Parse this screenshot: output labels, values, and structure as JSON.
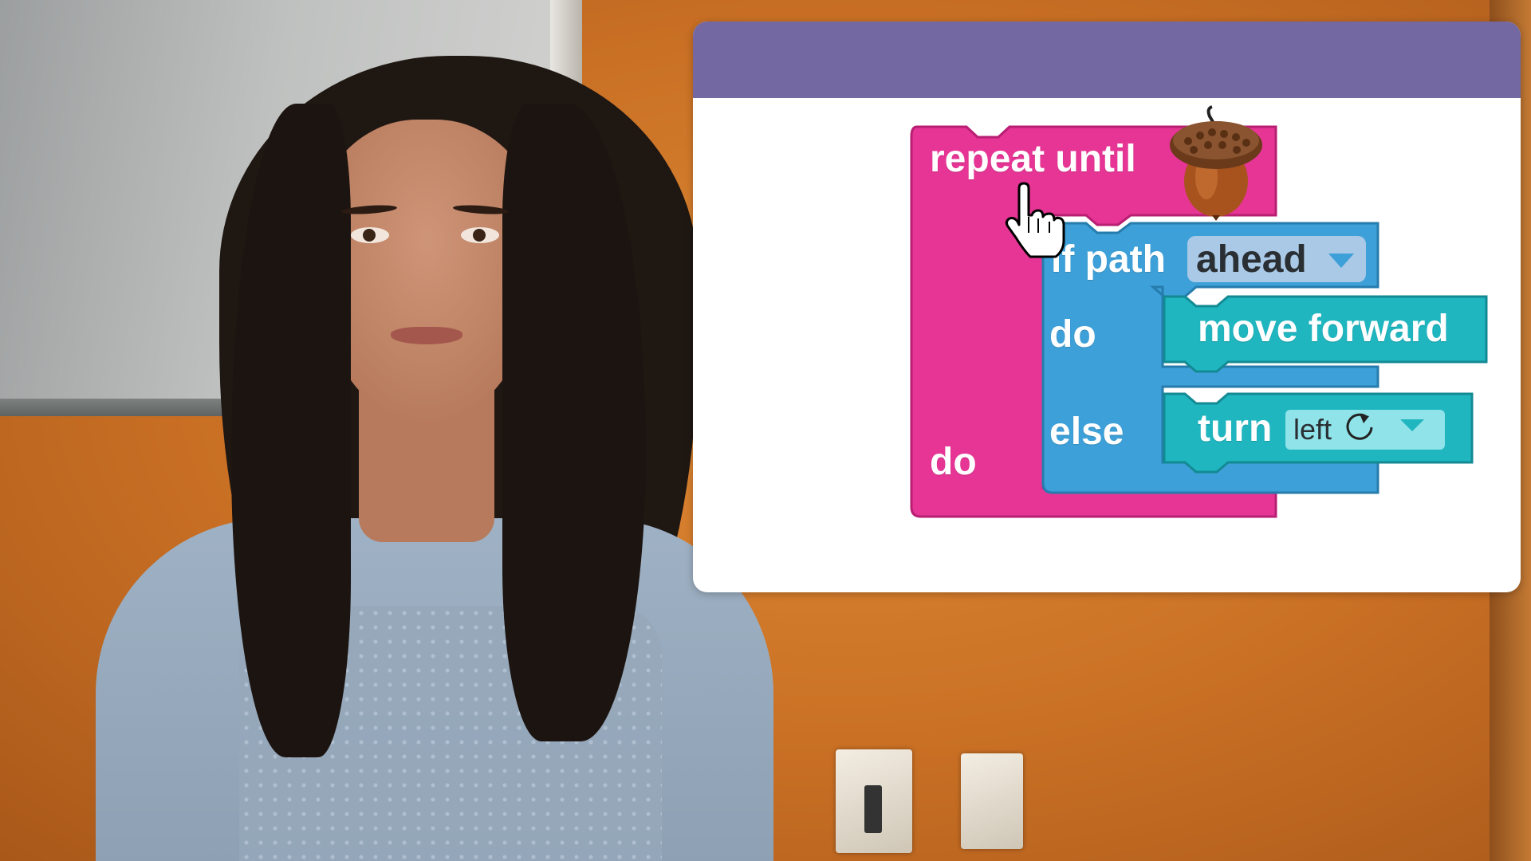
{
  "scene": {
    "description_free": true
  },
  "overlay": {
    "blocks": {
      "repeat": {
        "label": "repeat until",
        "do_label": "do",
        "color": "#e63595",
        "goal_icon": "acorn-icon"
      },
      "if_else": {
        "label": "if path",
        "dropdown_value": "ahead",
        "do_label": "do",
        "else_label": "else",
        "color": "#3ea0d8"
      },
      "move": {
        "label": "move forward",
        "color": "#1fb6c0"
      },
      "turn": {
        "label": "turn",
        "dropdown_value": "left",
        "rotate_icon": "rotate-counterclockwise-icon",
        "color": "#1fb6c0"
      }
    },
    "header_color": "#7468a3",
    "cursor_icon": "hand-pointer-icon"
  }
}
